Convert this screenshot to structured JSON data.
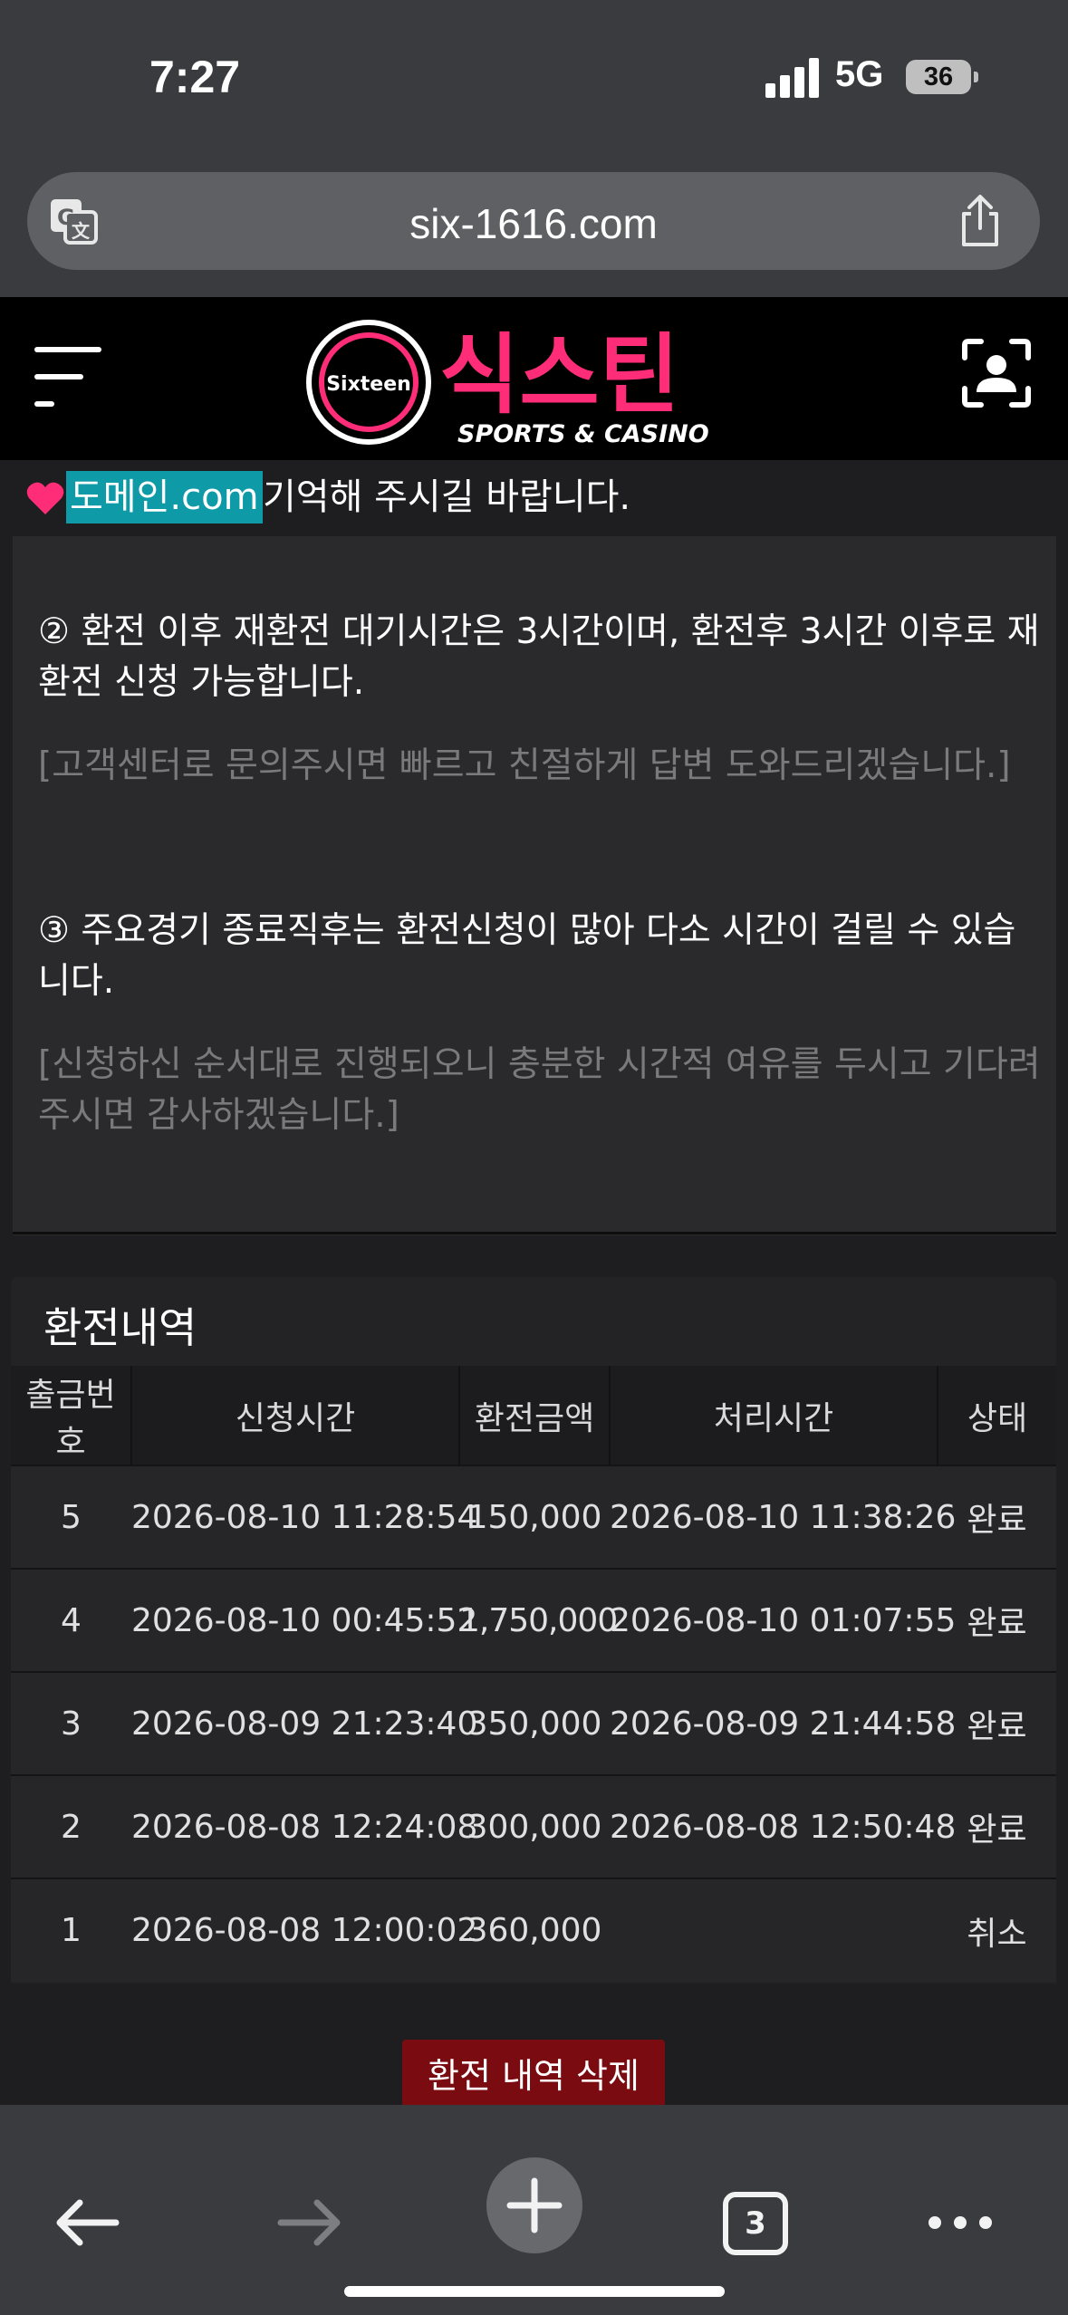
{
  "status": {
    "time": "7:27",
    "network": "5G",
    "battery": "36"
  },
  "browser": {
    "url": "six-1616.com",
    "tab_count": "3"
  },
  "site": {
    "logo_badge": "Sixteen",
    "logo_title": "식스틴",
    "logo_sub": "SPORTS & CASINO",
    "domain_highlight": "도메인.com",
    "domain_rest": "기억해 주시길 바랍니다."
  },
  "notice": {
    "item2": "② 환전 이후 재환전 대기시간은 3시간이며, 환전후 3시간 이후로 재환전 신청 가능합니다.",
    "item2_sub": "[고객센터로 문의주시면 빠르고 친절하게 답변 도와드리겠습니다.]",
    "item3": "③ 주요경기 종료직후는 환전신청이 많아 다소 시간이 걸릴 수 있습니다.",
    "item3_sub": "[신청하신 순서대로 진행되오니 충분한 시간적 여유를 두시고 기다려 주시면 감사하겠습니다.]"
  },
  "history": {
    "title": "환전내역",
    "columns": [
      "출금번호",
      "신청시간",
      "환전금액",
      "처리시간",
      "상태"
    ],
    "rows": [
      [
        "5",
        "2026-08-10 11:28:54",
        "150,000",
        "2026-08-10 11:38:26",
        "완료"
      ],
      [
        "4",
        "2026-08-10 00:45:52",
        "1,750,000",
        "2026-08-10 01:07:55",
        "완료"
      ],
      [
        "3",
        "2026-08-09 21:23:40",
        "350,000",
        "2026-08-09 21:44:58",
        "완료"
      ],
      [
        "2",
        "2026-08-08 12:24:08",
        "300,000",
        "2026-08-08 12:50:48",
        "완료"
      ],
      [
        "1",
        "2026-08-08 12:00:02",
        "360,000",
        "",
        "취소"
      ]
    ],
    "delete_label": "환전 내역 삭제"
  },
  "colors": {
    "accent_pink": "#ff2d78",
    "teal": "#0e9aa7",
    "delete_red": "#7a0b10"
  }
}
